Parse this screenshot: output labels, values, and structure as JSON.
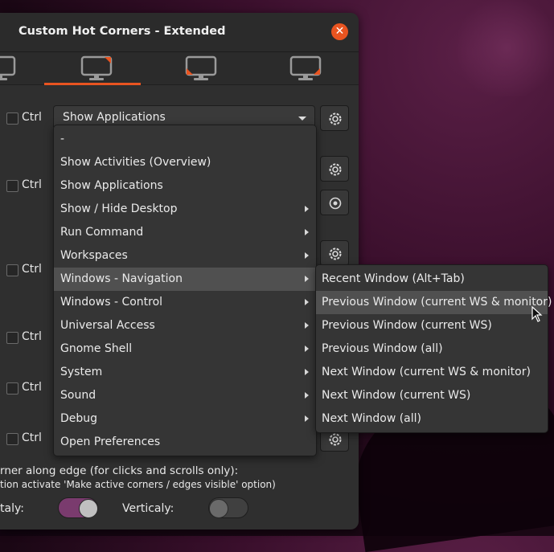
{
  "window": {
    "title": "Custom Hot Corners - Extended"
  },
  "rows": [
    {
      "ctrl_label": "Ctrl",
      "checked": false
    },
    {
      "ctrl_label": "Ctrl",
      "checked": false
    },
    {
      "ctrl_label": "Ctrl",
      "checked": false
    },
    {
      "ctrl_label": "Ctrl",
      "checked": false
    },
    {
      "ctrl_label": "Ctrl",
      "checked": false
    },
    {
      "ctrl_label": "Ctrl",
      "checked": false
    }
  ],
  "combo": {
    "selected": "Show Applications"
  },
  "menu": {
    "items": [
      {
        "label": "-",
        "submenu": false
      },
      {
        "label": "Show Activities (Overview)",
        "submenu": false
      },
      {
        "label": "Show Applications",
        "submenu": false
      },
      {
        "label": "Show / Hide Desktop",
        "submenu": true
      },
      {
        "label": "Run Command",
        "submenu": true
      },
      {
        "label": "Workspaces",
        "submenu": true
      },
      {
        "label": "Windows - Navigation",
        "submenu": true,
        "highlighted": true
      },
      {
        "label": "Windows - Control",
        "submenu": true
      },
      {
        "label": "Universal Access",
        "submenu": true
      },
      {
        "label": "Gnome Shell",
        "submenu": true
      },
      {
        "label": "System",
        "submenu": true
      },
      {
        "label": "Sound",
        "submenu": true
      },
      {
        "label": "Debug",
        "submenu": true
      },
      {
        "label": "Open Preferences",
        "submenu": false
      }
    ]
  },
  "submenu": {
    "items": [
      {
        "label": "Recent Window (Alt+Tab)"
      },
      {
        "label": "Previous Window (current WS & monitor)",
        "highlighted": true
      },
      {
        "label": "Previous Window (current WS)"
      },
      {
        "label": "Previous Window (all)"
      },
      {
        "label": "Next Window (current WS & monitor)"
      },
      {
        "label": "Next Window (current WS)"
      },
      {
        "label": "Next Window (all)"
      }
    ]
  },
  "footer": {
    "line1": "rner along edge (for clicks and scrolls only):",
    "line2": "tion activate 'Make active corners / edges visible' option)",
    "horizontal_label": "taly:",
    "horizontal_on": true,
    "vertical_label": "Verticaly:",
    "vertical_on": false
  },
  "colors": {
    "accent": "#e95420",
    "switch_on": "#7a3b6e",
    "menu_bg": "#353535",
    "window_bg": "#303030"
  }
}
